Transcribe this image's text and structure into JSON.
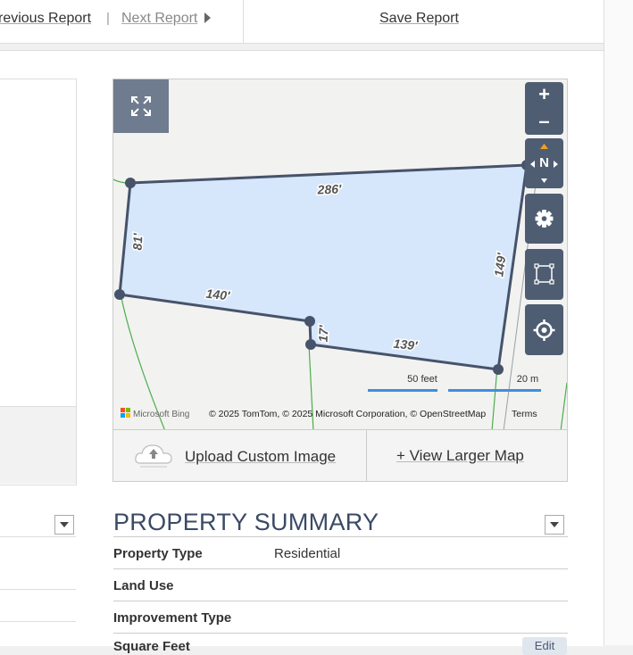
{
  "topbar": {
    "previous_report": "revious Report",
    "separator": "|",
    "next_report": "Next Report",
    "save_report": "Save Report"
  },
  "map": {
    "dimensions": [
      "286'",
      "81'",
      "140'",
      "17'",
      "139'",
      "149'"
    ],
    "scale_feet": "50 feet",
    "scale_meters": "20 m",
    "provider": "Microsoft Bing",
    "attribution": "© 2025 TomTom, © 2025 Microsoft Corporation, © OpenStreetMap",
    "terms": "Terms",
    "zoom_in": "+",
    "zoom_out": "–",
    "north": "N",
    "icons": [
      "expand-icon",
      "gear-icon",
      "select-area-icon",
      "locate-icon",
      "upload-cloud-icon",
      "compass-icon"
    ],
    "parcel_fill": "#d6e6fb",
    "parcel_stroke": "#47536a"
  },
  "map_footer": {
    "upload_label": "Upload Custom Image",
    "view_larger_label": "+ View Larger Map"
  },
  "property_summary": {
    "title": "PROPERTY SUMMARY",
    "rows": [
      {
        "label": "Property Type",
        "value": "Residential"
      },
      {
        "label": "Land Use",
        "value": ""
      },
      {
        "label": "Improvement Type",
        "value": ""
      },
      {
        "label": "Square Feet",
        "value": ""
      }
    ],
    "edit_label": "Edit"
  }
}
